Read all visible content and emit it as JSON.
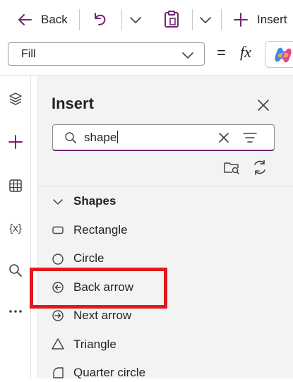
{
  "toolbar": {
    "back_label": "Back",
    "insert_label": "Insert"
  },
  "formula_bar": {
    "property_value": "Fill",
    "equals_sign": "=",
    "fx_label": "fx"
  },
  "insert_pane": {
    "title": "Insert",
    "search_value": "shape",
    "group_label": "Shapes",
    "items": [
      {
        "label": "Rectangle",
        "icon": "rectangle-icon"
      },
      {
        "label": "Circle",
        "icon": "circle-icon"
      },
      {
        "label": "Back arrow",
        "icon": "back-arrow-icon"
      },
      {
        "label": "Next arrow",
        "icon": "next-arrow-icon"
      },
      {
        "label": "Triangle",
        "icon": "triangle-icon"
      },
      {
        "label": "Quarter circle",
        "icon": "quarter-circle-icon"
      }
    ]
  },
  "rail": {
    "icons": [
      "layers-icon",
      "plus-icon",
      "table-icon",
      "variables-icon",
      "search-icon",
      "more-icon"
    ],
    "variables_text": "{x}"
  },
  "colors": {
    "accent": "#742774",
    "highlight": "#e0191f",
    "pane_background": "#f3f3f3"
  }
}
